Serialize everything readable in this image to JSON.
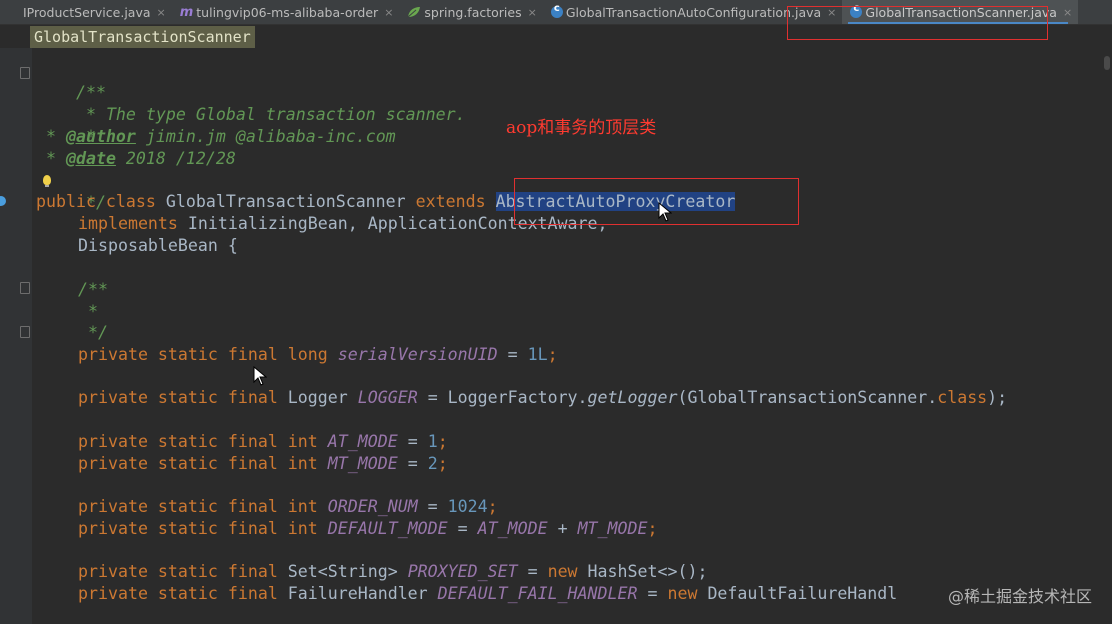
{
  "tabs": [
    {
      "label": "IProductService.java",
      "icon": "interface-icon",
      "active": false
    },
    {
      "label": "tulingvip06-ms-alibaba-order",
      "icon": "maven-icon",
      "active": false
    },
    {
      "label": "spring.factories",
      "icon": "spring-leaf-icon",
      "active": false
    },
    {
      "label": "GlobalTransactionAutoConfiguration.java",
      "icon": "class-icon",
      "active": false
    },
    {
      "label": "GlobalTransactionScanner.java",
      "icon": "class-icon",
      "active": true
    }
  ],
  "tab_close_glyph": "×",
  "breadcrumb": "GlobalTransactionScanner",
  "annotation": "aop和事务的顶层类",
  "watermark": "@稀土掘金技术社区",
  "colors": {
    "keyword": "#cc7832",
    "comment": "#629755",
    "field": "#9876aa",
    "number": "#6897bb",
    "default_text": "#a9b7c6",
    "selection": "#214283",
    "highlight_box": "#e03030",
    "annotation": "#ff3b30"
  },
  "code": {
    "doc_open": "/**",
    "doc_line1": " * The type Global transaction scanner.",
    "doc_star": " *",
    "author_prefix": " * ",
    "author_tag": "@author",
    "author_val": " jimin.jm @alibaba-inc.com",
    "date_prefix": " * ",
    "date_tag": "@date",
    "date_val": " 2018 /12/28",
    "doc_close": " */",
    "class_kw": "public class",
    "class_name": " GlobalTransactionScanner ",
    "extends_kw": "extends",
    "space": " ",
    "super_class": "AbstractAutoProxyCreator",
    "implements_kw": "implements",
    "interfaces": " InitializingBean, ApplicationContextAware,",
    "disposable": "DisposableBean {",
    "inner_doc_open": "/**",
    "inner_doc_star": " *",
    "inner_doc_close": " */",
    "psf": "private static final",
    "long_t": " long ",
    "serial_name": "serialVersionUID",
    "eq": " = ",
    "serial_val": "1L",
    "semi": ";",
    "logger_t": " Logger ",
    "logger_name": "LOGGER",
    "logger_factory": " = LoggerFactory.",
    "get_logger": "getLogger",
    "logger_arg": "(GlobalTransactionScanner.",
    "class_kw2": "class",
    "logger_end": ");",
    "int_t": " int ",
    "at_mode": "AT_MODE",
    "at_val": "1",
    "mt_mode": "MT_MODE",
    "mt_val": "2",
    "order_num": "ORDER_NUM",
    "order_val": "1024",
    "default_mode": "DEFAULT_MODE",
    "plus": " + ",
    "set_t": " Set<String> ",
    "proxied_set": "PROXYED_SET",
    "new_kw": "new",
    "hashset": " HashSet<>();",
    "failure_t": " FailureHandler ",
    "default_fail": "DEFAULT_FAIL_HANDLER",
    "default_failure_cls": " DefaultFailureHandl"
  }
}
